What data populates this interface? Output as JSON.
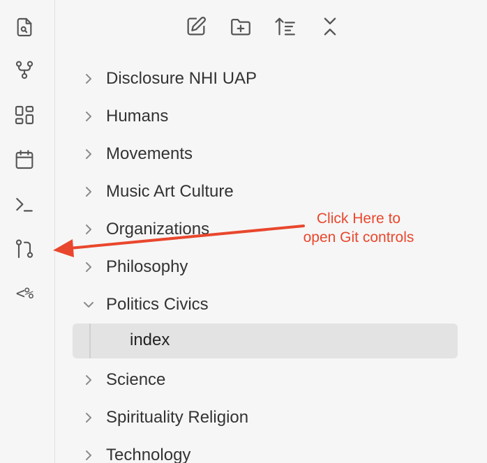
{
  "ribbon": {
    "items": [
      {
        "icon": "open-quick-switcher-icon"
      },
      {
        "icon": "graph-view-icon"
      },
      {
        "icon": "canvas-icon"
      },
      {
        "icon": "calendar-icon"
      },
      {
        "icon": "terminal-icon"
      },
      {
        "icon": "git-pull-request-icon"
      },
      {
        "icon": "templater-icon",
        "text": "<%"
      }
    ]
  },
  "toolbar": {
    "buttons": [
      {
        "icon": "new-note-icon"
      },
      {
        "icon": "new-folder-icon"
      },
      {
        "icon": "sort-icon"
      },
      {
        "icon": "collapse-all-icon"
      }
    ]
  },
  "tree": {
    "folders": [
      {
        "label": "Disclosure NHI UAP",
        "expanded": false
      },
      {
        "label": "Humans",
        "expanded": false
      },
      {
        "label": "Movements",
        "expanded": false
      },
      {
        "label": "Music Art Culture",
        "expanded": false
      },
      {
        "label": "Organizations",
        "expanded": false
      },
      {
        "label": "Philosophy",
        "expanded": false
      },
      {
        "label": "Politics Civics",
        "expanded": true
      },
      {
        "label": "Science",
        "expanded": false
      },
      {
        "label": "Spirituality Religion",
        "expanded": false
      },
      {
        "label": "Technology",
        "expanded": false
      }
    ],
    "open_file": {
      "label": "index",
      "parent": "Politics Civics"
    }
  },
  "annotation": {
    "line1": "Click Here to",
    "line2": "open Git controls",
    "color": "#e9472d"
  },
  "colors": {
    "background": "#f6f6f6",
    "selected_row": "#e3e3e3",
    "icon": "#555555",
    "text": "#333333",
    "annotation": "#e9472d"
  }
}
